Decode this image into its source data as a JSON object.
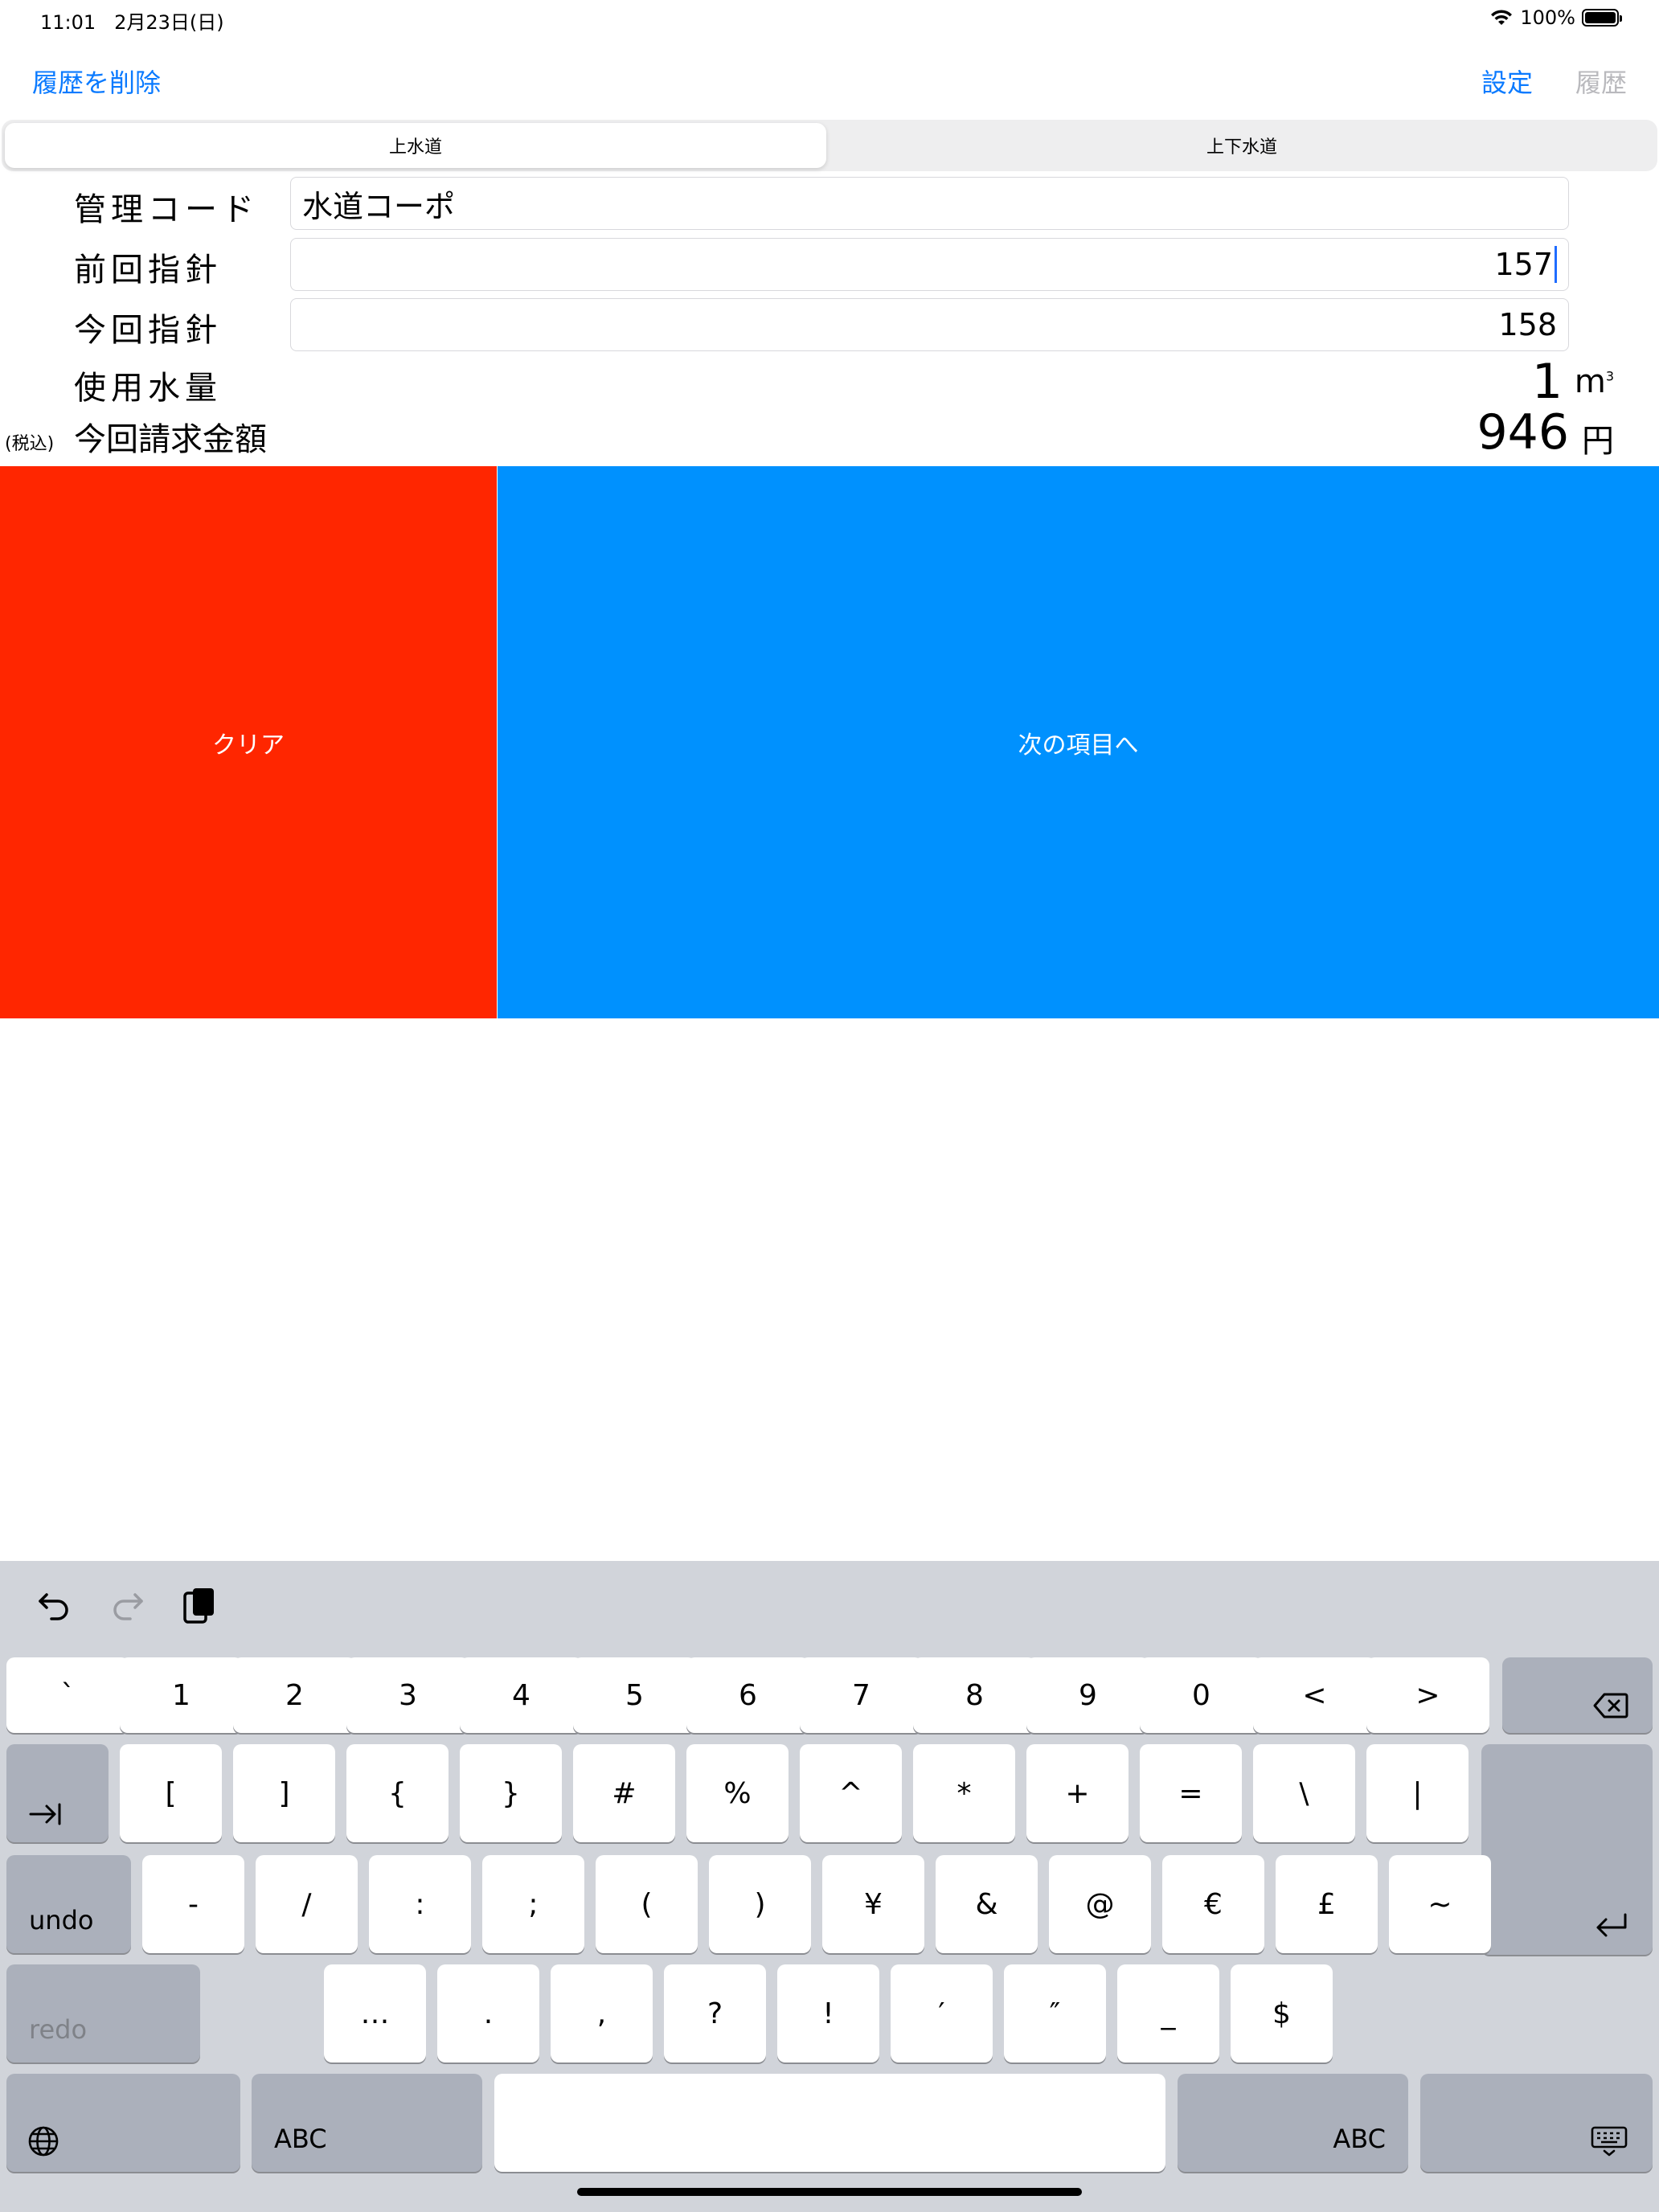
{
  "status_bar": {
    "time": "11:01",
    "date": "2月23日(日)",
    "battery": "100%"
  },
  "nav": {
    "delete_history": "履歴を削除",
    "settings": "設定",
    "history": "履歴"
  },
  "tabs": [
    {
      "label": "上水道",
      "selected": true
    },
    {
      "label": "上下水道",
      "selected": false
    }
  ],
  "form": {
    "management_code": {
      "label": "管理コード",
      "value": "水道コーポ"
    },
    "previous_reading": {
      "label": "前回指針",
      "value": "157"
    },
    "current_reading": {
      "label": "今回指針",
      "value": "158"
    },
    "water_usage": {
      "label": "使用水量",
      "value": "1",
      "unit": "m",
      "unit_sup": "3"
    },
    "billing": {
      "tax_note": "(税込)",
      "label": "今回請求金額",
      "value": "946",
      "unit": "円"
    }
  },
  "buttons": {
    "clear": "クリア",
    "next": "次の項目へ",
    "clear_color": "#ff2600",
    "next_color": "#0091fe"
  },
  "keyboard": {
    "toolbar": [
      "undo-icon",
      "redo-icon",
      "paste-icon"
    ],
    "row1": [
      "`",
      "1",
      "2",
      "3",
      "4",
      "5",
      "6",
      "7",
      "8",
      "9",
      "0",
      "<",
      ">"
    ],
    "row2": [
      "[",
      "]",
      "{",
      "}",
      "#",
      "%",
      "^",
      "*",
      "+",
      "=",
      "\\",
      "|"
    ],
    "row3": [
      "-",
      "/",
      ":",
      ";",
      "(",
      ")",
      "¥",
      "&",
      "@",
      "€",
      "£",
      "~"
    ],
    "row4": [
      "…",
      ".",
      ",",
      "?",
      "!",
      "′",
      "″",
      "_",
      "$"
    ],
    "undo_label": "undo",
    "redo_label": "redo",
    "abc_left": "ABC",
    "abc_right": "ABC"
  }
}
